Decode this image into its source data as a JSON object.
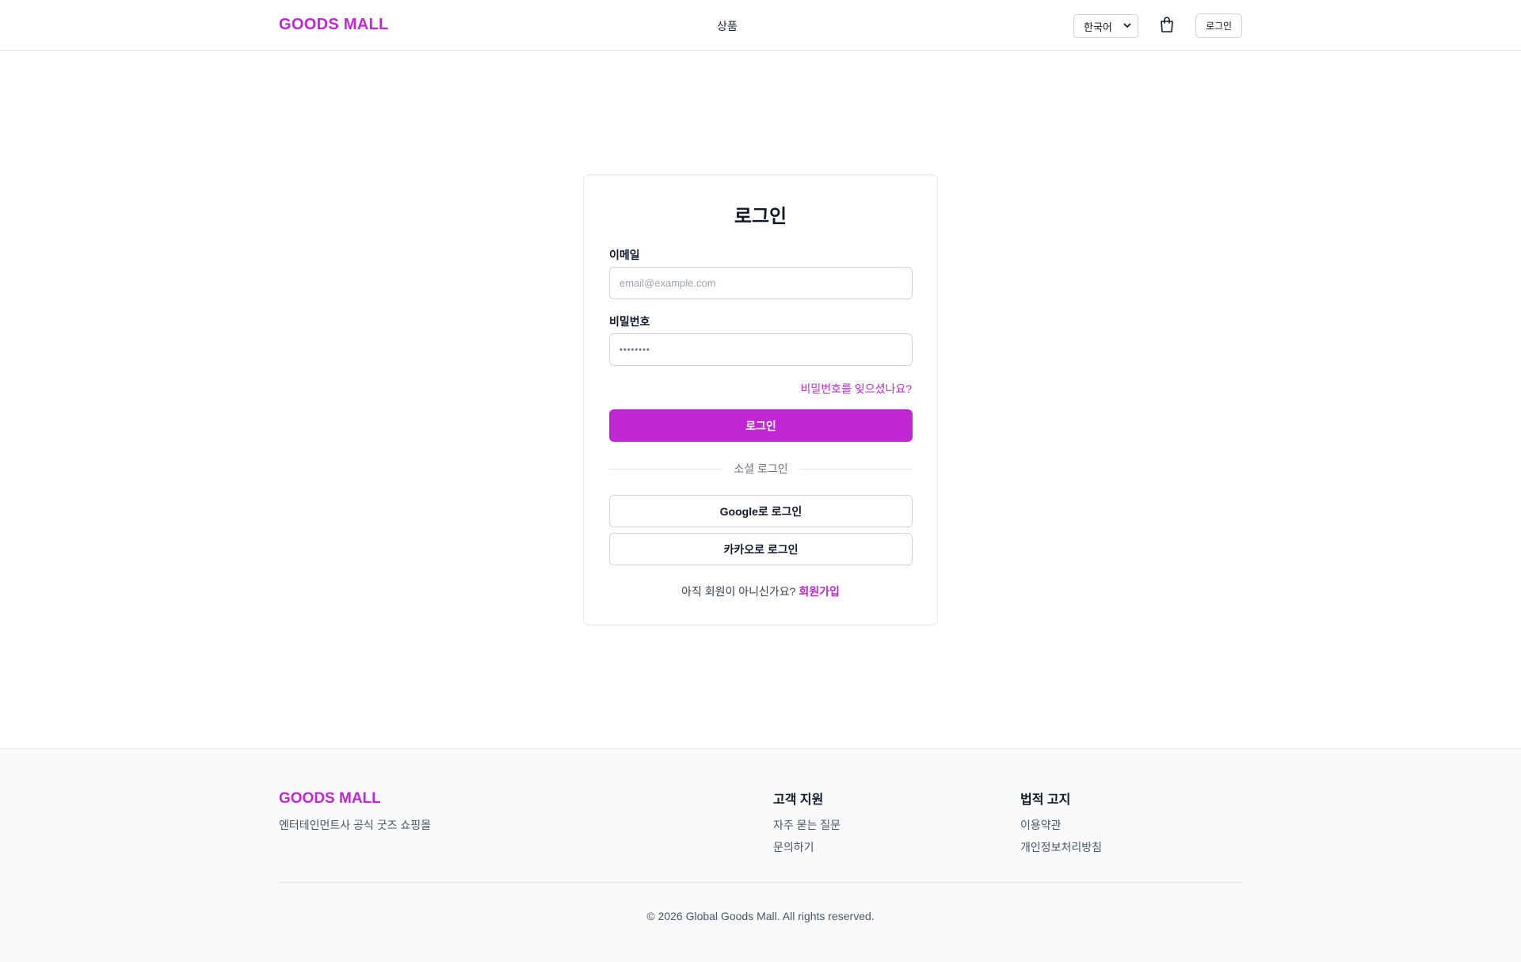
{
  "header": {
    "logo": "GOODS MALL",
    "nav_products": "상품",
    "language_selected": "한국어",
    "cart_icon": "shopping-bag-icon",
    "login_button": "로그인"
  },
  "login_card": {
    "title": "로그인",
    "email_label": "이메일",
    "email_placeholder": "email@example.com",
    "password_label": "비밀번호",
    "password_value": "••••••••",
    "forgot_password": "비밀번호를 잊으셨나요?",
    "submit_button": "로그인",
    "social_divider": "소셜 로그인",
    "google_button": "Google로 로그인",
    "kakao_button": "카카오로 로그인",
    "signup_prompt": "아직 회원이 아니신가요?",
    "signup_link": "회원가입"
  },
  "footer": {
    "logo": "GOODS MALL",
    "tagline": "엔터테인먼트사 공식 굿즈 쇼핑몰",
    "support": {
      "heading": "고객 지원",
      "items": [
        "자주 묻는 질문",
        "문의하기"
      ]
    },
    "legal": {
      "heading": "법적 고지",
      "items": [
        "이용약관",
        "개인정보처리방침"
      ]
    },
    "copyright": "© 2026 Global Goods Mall. All rights reserved."
  },
  "colors": {
    "accent": "#c026d3",
    "border": "#e5e7eb",
    "footer_bg": "#f9fafb"
  }
}
